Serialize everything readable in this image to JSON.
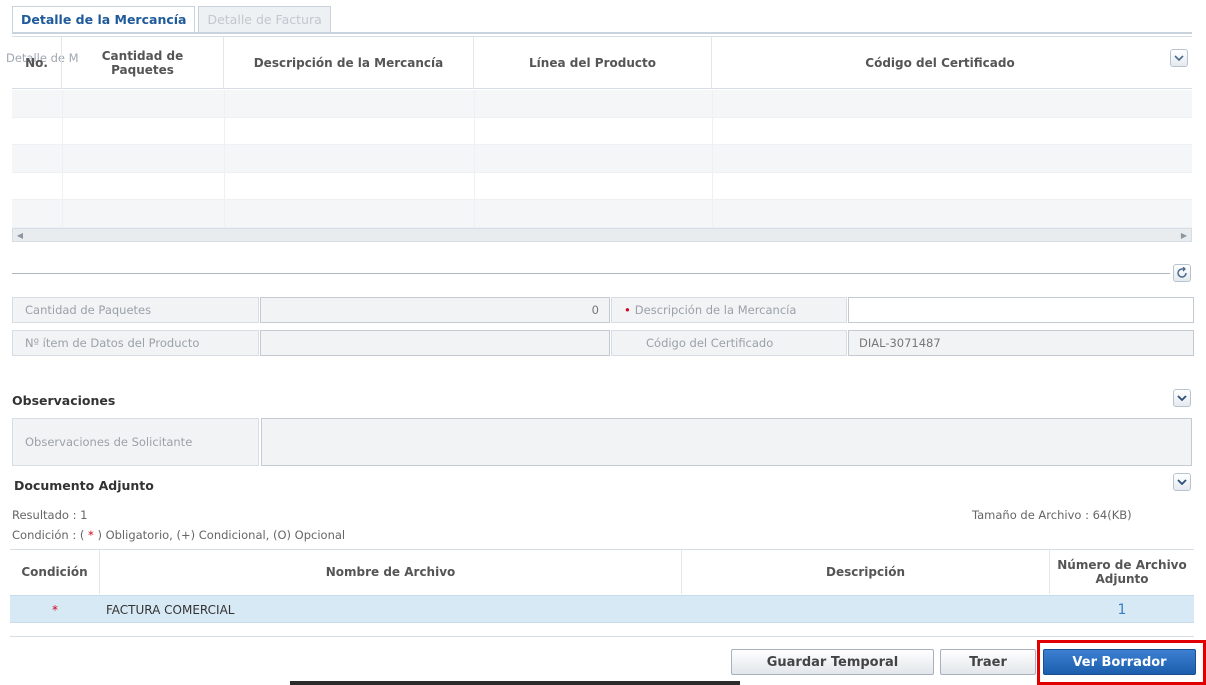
{
  "tabs": [
    {
      "label": "Detalle de la Mercancía",
      "active": true
    },
    {
      "label": "Detalle de Factura",
      "active": false
    }
  ],
  "grid": {
    "prefix_text": "Detalle de M",
    "columns": [
      "No.",
      "Cantidad de\nPaquetes",
      "Descripción de la Mercancía",
      "Línea del Producto",
      "Código del Certificado"
    ]
  },
  "form": {
    "cantidad_label": "Cantidad de Paquetes",
    "cantidad_value": "0",
    "descripcion_label": "Descripción de la Mercancía",
    "descripcion_value": "",
    "item_label": "Nº ítem de Datos del Producto",
    "item_value": "",
    "codigo_label": "Código del Certificado",
    "codigo_value": "DIAL-3071487"
  },
  "observaciones": {
    "title": "Observaciones",
    "label": "Observaciones de Solicitante",
    "value": ""
  },
  "documento": {
    "title": "Documento Adjunto",
    "resultado": "Resultado : 1",
    "tamano": "Tamaño de Archivo : 64(KB)",
    "condicion_prefix": "Condición : (",
    "condicion_star": " * ",
    "condicion_suffix": ") Obligatorio, (+) Condicional, (O) Opcional",
    "columns": [
      "Condición",
      "Nombre de Archivo",
      "Descripción",
      "Número de Archivo\nAdjunto"
    ],
    "rows": [
      {
        "condicion": "*",
        "nombre": "FACTURA COMERCIAL",
        "descripcion": "",
        "numero": "1"
      }
    ]
  },
  "buttons": {
    "guardar": "Guardar Temporal",
    "traer": "Traer",
    "ver": "Ver Borrador"
  },
  "colors": {
    "accent": "#1e5a9c",
    "primary_button": "#1b5eae",
    "highlight": "#e10000",
    "selected_row": "#d8e9f6"
  }
}
